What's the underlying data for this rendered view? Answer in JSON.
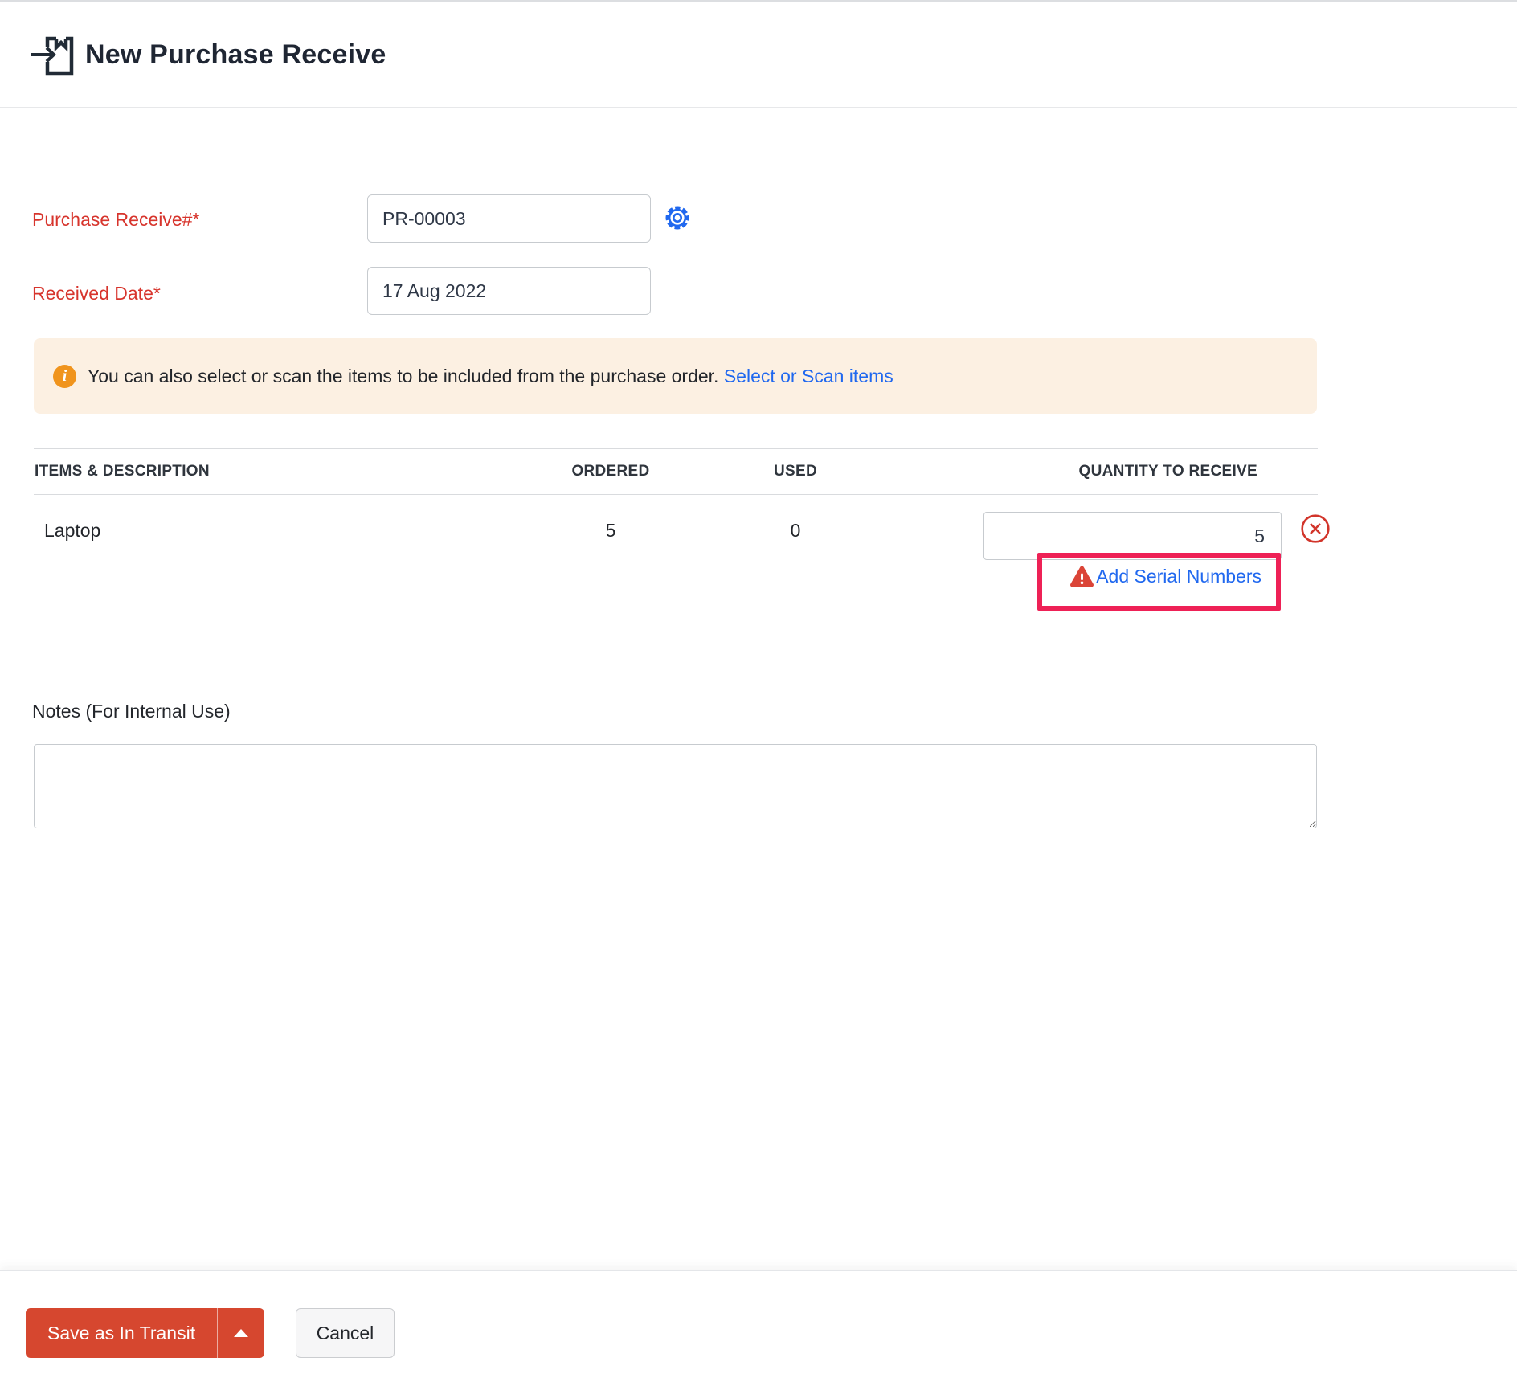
{
  "header": {
    "title": "New Purchase Receive"
  },
  "form": {
    "purchase_receive_label": "Purchase Receive#*",
    "purchase_receive_value": "PR-00003",
    "received_date_label": "Received Date*",
    "received_date_value": "17 Aug 2022"
  },
  "banner": {
    "text": "You can also select or scan the items to be included from the purchase order.",
    "link_label": "Select or Scan items"
  },
  "items_table": {
    "columns": [
      "ITEMS & DESCRIPTION",
      "ORDERED",
      "USED",
      "QUANTITY TO RECEIVE"
    ],
    "rows": [
      {
        "name": "Laptop",
        "ordered": "5",
        "used": "0",
        "quantity_to_receive": "5"
      }
    ],
    "add_serial_label": "Add Serial Numbers"
  },
  "notes": {
    "label": "Notes (For Internal Use)",
    "value": ""
  },
  "footer": {
    "save_label": "Save as In Transit",
    "cancel_label": "Cancel"
  },
  "icons": {
    "header": "purchase-receive-box-arrow",
    "settings": "gear",
    "info": "i",
    "warning": "exclamation-triangle",
    "delete": "circle-x",
    "dropdown": "caret-up"
  },
  "colors": {
    "required_label_red": "#d7342c",
    "link_blue": "#2068ef",
    "banner_background": "#fcf0e2",
    "info_icon_orange": "#f0941d",
    "warning_triangle_red": "#db4437",
    "delete_icon_red": "#d2352b",
    "annotation_highlight": "#ee2156",
    "save_button_red": "#d6472f",
    "table_border_gray": "#d9dbde"
  }
}
